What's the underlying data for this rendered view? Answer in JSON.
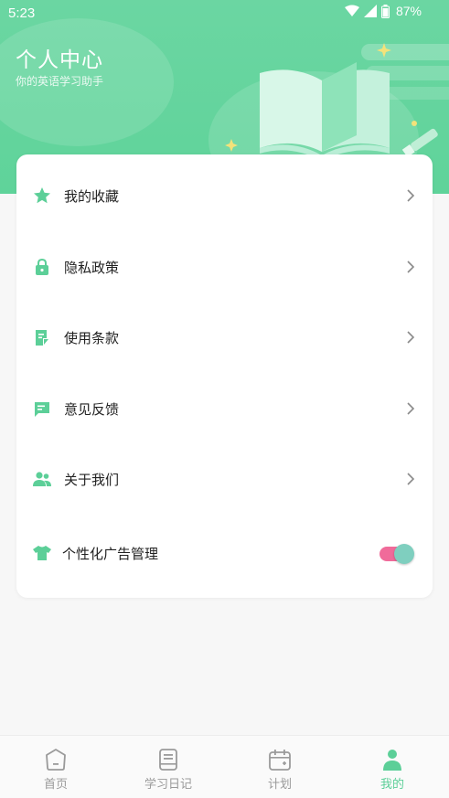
{
  "status_bar": {
    "time": "5:23",
    "battery": "87%"
  },
  "header": {
    "title": "个人中心",
    "subtitle": "你的英语学习助手"
  },
  "menu": {
    "items": [
      {
        "label": "我的收藏",
        "icon": "star-icon"
      },
      {
        "label": "隐私政策",
        "icon": "lock-icon"
      },
      {
        "label": "使用条款",
        "icon": "document-icon"
      },
      {
        "label": "意见反馈",
        "icon": "feedback-icon"
      },
      {
        "label": "关于我们",
        "icon": "people-icon"
      }
    ],
    "ads_toggle": {
      "label": "个性化广告管理",
      "icon": "shirt-icon",
      "on": true
    }
  },
  "tabs": [
    {
      "label": "首页",
      "icon": "home-icon",
      "active": false
    },
    {
      "label": "学习日记",
      "icon": "notebook-icon",
      "active": false
    },
    {
      "label": "计划",
      "icon": "calendar-icon",
      "active": false
    },
    {
      "label": "我的",
      "icon": "person-icon",
      "active": true
    }
  ],
  "colors": {
    "accent": "#5ccf98",
    "toggle_track": "#f06b9a",
    "toggle_knob": "#7fcfbf"
  }
}
